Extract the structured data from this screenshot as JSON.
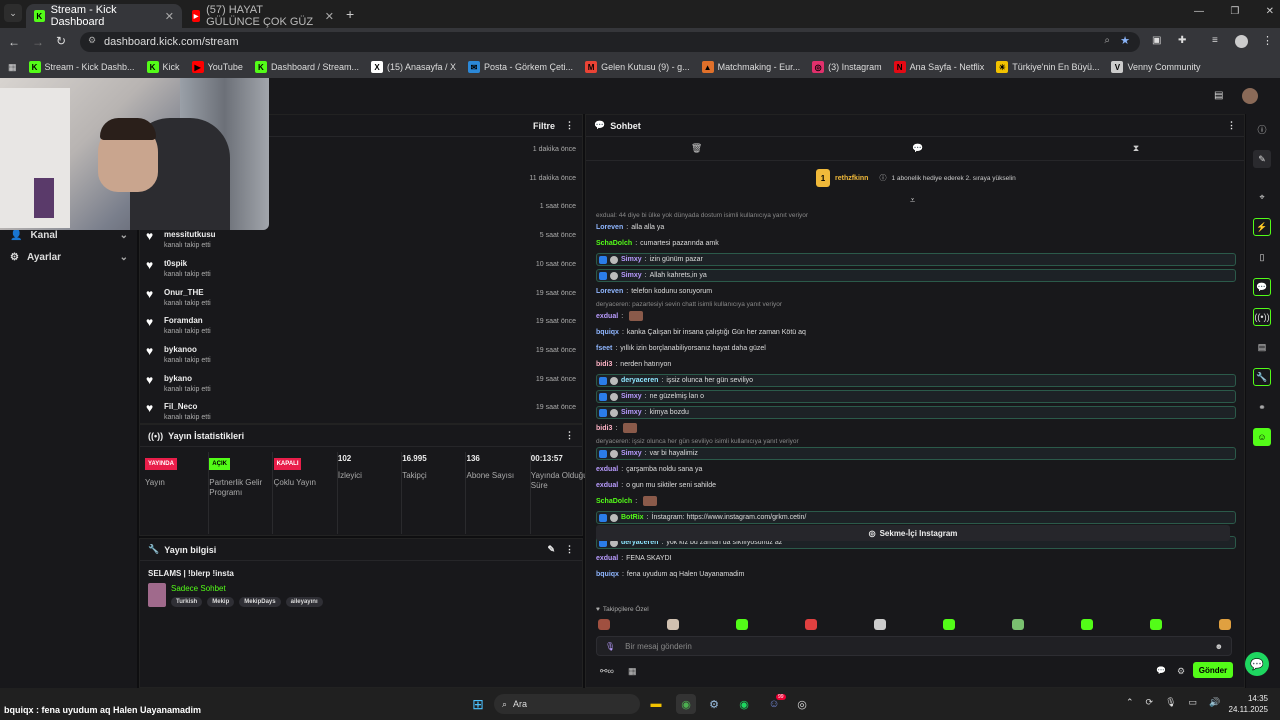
{
  "tabs": [
    {
      "label": "Stream - Kick Dashboard"
    },
    {
      "label": "(57) HAYAT GÜLÜNCE ÇOK GÜZ"
    }
  ],
  "address": {
    "url": "dashboard.kick.com/stream"
  },
  "bookmarks": [
    {
      "label": "Stream - Kick Dashb...",
      "color": "#53fc18",
      "icon": "K"
    },
    {
      "label": "Kick",
      "color": "#53fc18",
      "icon": "K"
    },
    {
      "label": "YouTube",
      "color": "#ff0000",
      "icon": "▶"
    },
    {
      "label": "Dashboard / Stream...",
      "color": "#53fc18",
      "icon": "K"
    },
    {
      "label": "(15) Anasayfa / X",
      "color": "#ffffff",
      "icon": "X"
    },
    {
      "label": "Posta - Görkem Çeti...",
      "color": "#2b88d8",
      "icon": "✉"
    },
    {
      "label": "Gelen Kutusu (9) - g...",
      "color": "#ea4335",
      "icon": "M"
    },
    {
      "label": "Matchmaking - Eur...",
      "color": "#e0702a",
      "icon": "▲"
    },
    {
      "label": "(3) Instagram",
      "color": "#e1306c",
      "icon": "◎"
    },
    {
      "label": "Ana Sayfa - Netflix",
      "color": "#e50914",
      "icon": "N"
    },
    {
      "label": "Türkiye'nin En Büyü...",
      "color": "#f2c200",
      "icon": "☀"
    },
    {
      "label": "Venny Community",
      "color": "#cccccc",
      "icon": "V"
    }
  ],
  "nav": {
    "channel": "Kanal",
    "settings": "Ayarlar"
  },
  "activity": {
    "filter": "Filtre",
    "items": [
      {
        "name": "",
        "sub": "",
        "time": "1 dakika önce"
      },
      {
        "name": "",
        "sub": "",
        "time": "11 dakika önce"
      },
      {
        "name": "",
        "sub": "",
        "time": "1 saat önce"
      },
      {
        "name": "messitutkusu",
        "sub": "kanalı takip etti",
        "time": "5 saat önce"
      },
      {
        "name": "t0spik",
        "sub": "kanalı takip etti",
        "time": "10 saat önce"
      },
      {
        "name": "Onur_THE",
        "sub": "kanalı takip etti",
        "time": "19 saat önce"
      },
      {
        "name": "Foramdan",
        "sub": "kanalı takip etti",
        "time": "19 saat önce"
      },
      {
        "name": "bykanoo",
        "sub": "kanalı takip etti",
        "time": "19 saat önce"
      },
      {
        "name": "bykano",
        "sub": "kanalı takip etti",
        "time": "19 saat önce"
      },
      {
        "name": "Fil_Neco",
        "sub": "kanalı takip etti",
        "time": "19 saat önce"
      }
    ]
  },
  "stats": {
    "title": "Yayın İstatistikleri",
    "items": [
      {
        "badge": "YAYINDA",
        "badge_color": "#e91e4a",
        "label": "Yayın"
      },
      {
        "badge": "AÇIK",
        "badge_color": "#53fc18",
        "label": "Partnerlik Gelir Programı"
      },
      {
        "badge": "KAPALI",
        "badge_color": "#e91e4a",
        "label": "Çoklu Yayın"
      },
      {
        "value": "102",
        "label": "İzleyici"
      },
      {
        "value": "16.995",
        "label": "Takipçi"
      },
      {
        "value": "136",
        "label": "Abone Sayısı"
      },
      {
        "value": "00:13:57",
        "label": "Yayında Olduğu Süre"
      }
    ]
  },
  "info": {
    "title": "Yayın bilgisi",
    "stream_title": "SELAMS | !blerp !insta",
    "category": "Sadece Sohbet",
    "tags": [
      "Turkish",
      "Mekip",
      "MekipDays",
      "aileyayını"
    ]
  },
  "chat": {
    "title": "Sohbet",
    "pinned_user": "rethzfkinn",
    "pinned_badge": "1",
    "pinned_text": "1 abonelik hediye ederek 2. sıraya yükselin",
    "messages": [
      {
        "type": "reply",
        "text": "exdual: 44 diye bi ülke yok dünyada dostum isimli kullanıcıya yanıt veriyor"
      },
      {
        "user": "Loreven",
        "color": "#8fb6ff",
        "text": "alla alla ya"
      },
      {
        "user": "SchaDolch",
        "color": "#53fc18",
        "text": "cumartesi pazarında amk"
      },
      {
        "user": "Simxy",
        "color": "#b99cff",
        "text": "izin günüm pazar",
        "hl": true
      },
      {
        "user": "Simxy",
        "color": "#b99cff",
        "text": "Allah kahrets,in ya",
        "hl": true
      },
      {
        "user": "Loreven",
        "color": "#8fb6ff",
        "text": "telefon kodunu soruyorum"
      },
      {
        "type": "reply",
        "text": "deryaceren: pazartesiyi sevin chatt isimli kullanıcıya yanıt veriyor"
      },
      {
        "user": "exdual",
        "color": "#b99cff",
        "text": ""
      },
      {
        "user": "bquiqx",
        "color": "#8fb6ff",
        "text": "kanka Çalışan bir insana çalıştığı Gün her zaman Kötü aq"
      },
      {
        "user": "fseet",
        "color": "#8fb6ff",
        "text": "yıllık izin borçlanabiliyorsanız hayat daha güzel"
      },
      {
        "user": "bidi3",
        "color": "#ffb3c6",
        "text": "nerden hatırıyon"
      },
      {
        "user": "deryaceren",
        "color": "#8fe6ff",
        "text": "işsiz olunca her gün seviliyo",
        "hl": true
      },
      {
        "user": "Simxy",
        "color": "#b99cff",
        "text": "ne güzelmiş lan o",
        "hl": true
      },
      {
        "user": "Simxy",
        "color": "#b99cff",
        "text": "kimya bozdu",
        "hl": true
      },
      {
        "user": "bidi3",
        "color": "#ffb3c6",
        "text": ""
      },
      {
        "type": "reply",
        "text": "deryaceren: işsiz olunca her gün seviliyo isimli kullanıcıya yanıt veriyor"
      },
      {
        "user": "Simxy",
        "color": "#b99cff",
        "text": "var bi hayalimiz",
        "hl": true
      },
      {
        "user": "exdual",
        "color": "#b99cff",
        "text": "çarşamba noldu sana ya"
      },
      {
        "user": "exdual",
        "color": "#b99cff",
        "text": "o gun mu siktiler seni sahilde"
      },
      {
        "user": "SchaDolch",
        "color": "#53fc18",
        "text": ""
      },
      {
        "user": "BotRix",
        "color": "#53fc18",
        "text": "İnstagram: https://www.instagram.com/grkm.cetin/",
        "hl": true
      },
      {
        "type": "reply",
        "text": "Simxy: var bi hayalimiz isimli kullanıcıya yanıt veriyor"
      },
      {
        "user": "deryaceren",
        "color": "#8fe6ff",
        "text": "yok kız bu zaman da sıkılıyosunuz az",
        "hl": true
      },
      {
        "user": "exdual",
        "color": "#b99cff",
        "text": "FENA SKAYDI"
      },
      {
        "user": "bquiqx",
        "color": "#8fb6ff",
        "text": "fena uyudum aq Halen Uayanamadim"
      }
    ],
    "instagram_button": "Sekme-İçi Instagram",
    "emote_section": "Takipçilere Özel",
    "input_placeholder": "Bir mesaj gönderin",
    "send": "Gönder"
  },
  "taskbar": {
    "search": "Ara",
    "time": "14:35",
    "date": "24.11.2025",
    "overlay": "bquiqx : fena uyudum aq Halen Uayanamadim",
    "badge": "99"
  }
}
